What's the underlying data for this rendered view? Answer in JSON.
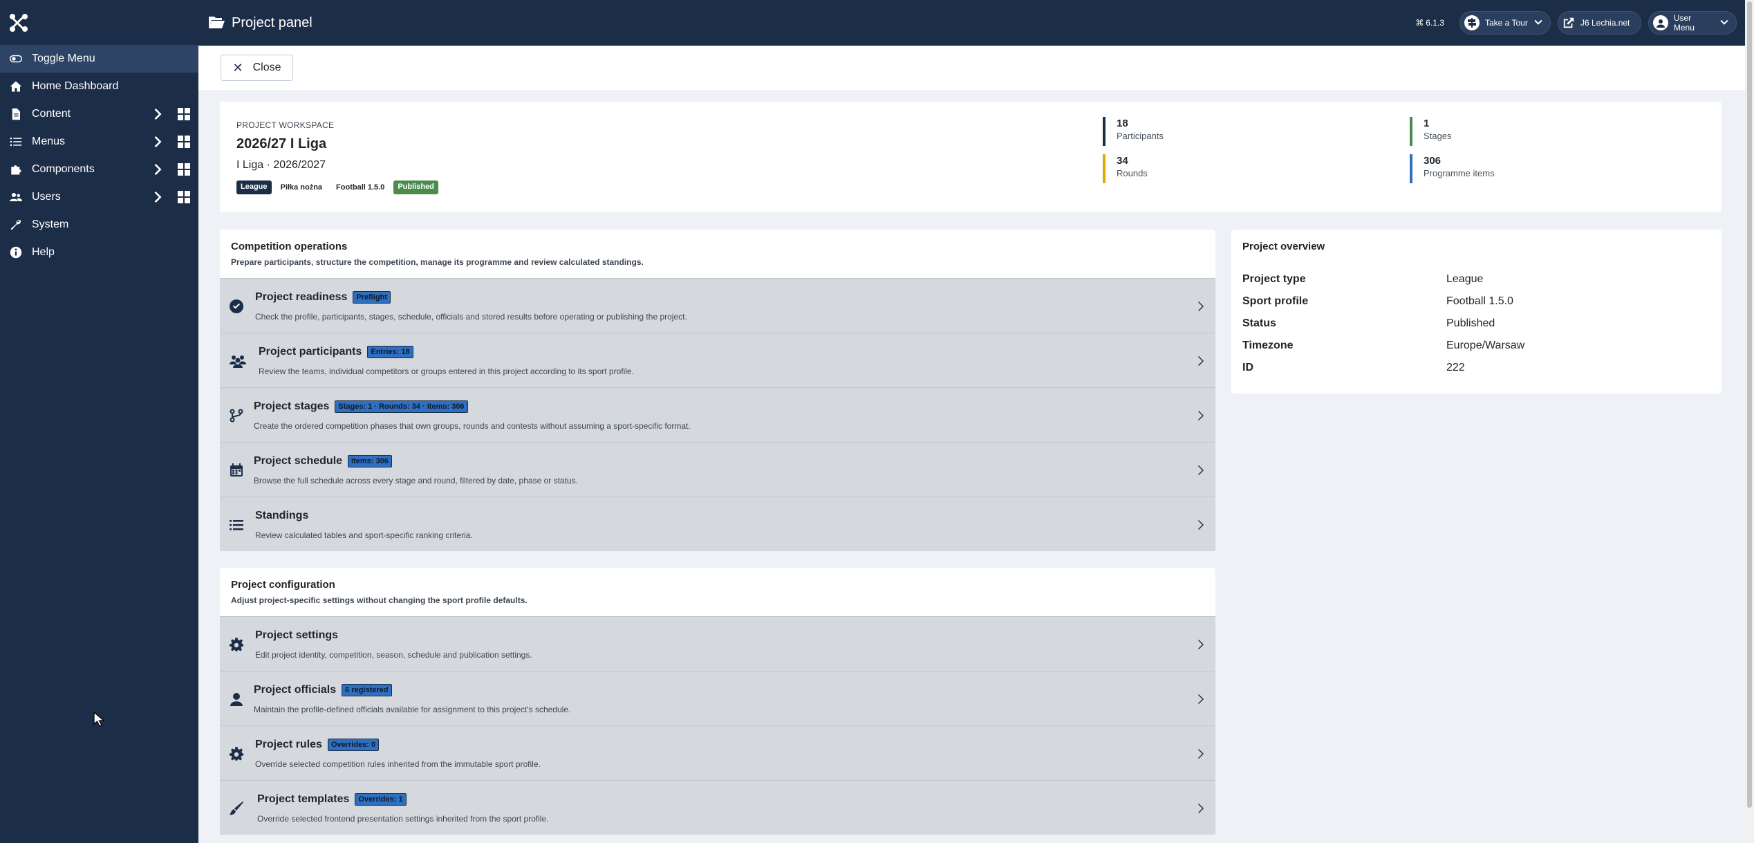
{
  "brand": {
    "name": "Joomla!"
  },
  "sidebar": {
    "items": [
      {
        "label": "Toggle Menu",
        "icon": "toggle-icon"
      },
      {
        "label": "Home Dashboard",
        "icon": "home-icon"
      },
      {
        "label": "Content",
        "icon": "file-icon"
      },
      {
        "label": "Menus",
        "icon": "list-icon"
      },
      {
        "label": "Components",
        "icon": "puzzle-icon"
      },
      {
        "label": "Users",
        "icon": "users-icon"
      },
      {
        "label": "System",
        "icon": "wrench-icon"
      },
      {
        "label": "Help",
        "icon": "info-icon"
      }
    ]
  },
  "header": {
    "title": "Project panel",
    "version": "6.1.3",
    "tour_label": "Take a Tour",
    "site_label": "J6 Lechia.net",
    "user_menu_label": "User Menu"
  },
  "toolbar": {
    "close_label": "Close"
  },
  "workspace": {
    "eyebrow": "PROJECT WORKSPACE",
    "title": "2026/27 I Liga",
    "subtitle": "I Liga · 2026/2027",
    "badges": [
      "League",
      "Piłka nożna",
      "Football 1.5.0",
      "Published"
    ],
    "stats": [
      {
        "value": "18",
        "label": "Participants",
        "color": "#1c2e47"
      },
      {
        "value": "1",
        "label": "Stages",
        "color": "#4b8c4d"
      },
      {
        "value": "34",
        "label": "Rounds",
        "color": "#e0a800"
      },
      {
        "value": "306",
        "label": "Programme items",
        "color": "#2f6fbf"
      }
    ]
  },
  "operations": {
    "title": "Competition operations",
    "description": "Prepare participants, structure the competition, manage its programme and review calculated standings.",
    "items": [
      {
        "title": "Project readiness",
        "badge": "Preflight",
        "description": "Check the profile, participants, stages, schedule, officials and stored results before operating or publishing the project.",
        "icon": "check-circle-icon"
      },
      {
        "title": "Project participants",
        "badge": "Entries: 18",
        "description": "Review the teams, individual competitors or groups entered in this project according to its sport profile.",
        "icon": "users-icon"
      },
      {
        "title": "Project stages",
        "badge": "Stages: 1 · Rounds: 34 · Items: 306",
        "description": "Create the ordered competition phases that own groups, rounds and contests without assuming a sport-specific format.",
        "icon": "branch-icon"
      },
      {
        "title": "Project schedule",
        "badge": "Items: 306",
        "description": "Browse the full schedule across every stage and round, filtered by date, phase or status.",
        "icon": "calendar-icon"
      },
      {
        "title": "Standings",
        "badge": "",
        "description": "Review calculated tables and sport-specific ranking criteria.",
        "icon": "list-icon"
      }
    ]
  },
  "configuration": {
    "title": "Project configuration",
    "description": "Adjust project-specific settings without changing the sport profile defaults.",
    "items": [
      {
        "title": "Project settings",
        "badge": "",
        "description": "Edit project identity, competition, season, schedule and publication settings.",
        "icon": "gear-icon"
      },
      {
        "title": "Project officials",
        "badge": "6 registered",
        "description": "Maintain the profile-defined officials available for assignment to this project's schedule.",
        "icon": "person-icon"
      },
      {
        "title": "Project rules",
        "badge": "Overrides: 0",
        "description": "Override selected competition rules inherited from the immutable sport profile.",
        "icon": "gear-icon"
      },
      {
        "title": "Project templates",
        "badge": "Overrides: 1",
        "description": "Override selected frontend presentation settings inherited from the sport profile.",
        "icon": "brush-icon"
      }
    ]
  },
  "overview": {
    "title": "Project overview",
    "rows": [
      {
        "key": "Project type",
        "value": "League"
      },
      {
        "key": "Sport profile",
        "value": "Football 1.5.0"
      },
      {
        "key": "Status",
        "value": "Published"
      },
      {
        "key": "Timezone",
        "value": "Europe/Warsaw"
      },
      {
        "key": "ID",
        "value": "222"
      }
    ]
  }
}
